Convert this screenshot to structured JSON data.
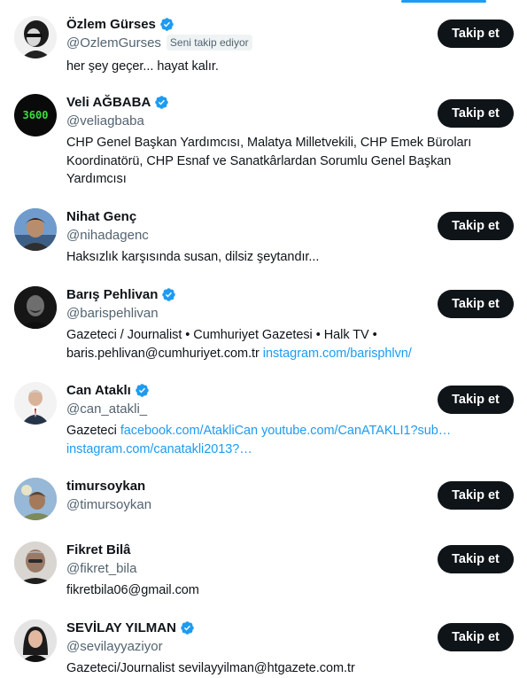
{
  "users": [
    {
      "name": "Özlem Gürses",
      "handle": "@OzlemGurses",
      "follows_you": "Seni takip ediyor",
      "bio": "her şey geçer... hayat kalır.",
      "bio_links": [],
      "verified": true,
      "follow_label": "Takip et"
    },
    {
      "name": "Veli AĞBABA",
      "handle": "@veliagbaba",
      "bio": "CHP Genel Başkan Yardımcısı, Malatya Milletvekili, CHP Emek Büroları Koordinatörü, CHP Esnaf ve Sanatkârlardan Sorumlu Genel Başkan Yardımcısı",
      "bio_links": [],
      "verified": true,
      "avatar_text": "3600",
      "follow_label": "Takip et"
    },
    {
      "name": "Nihat Genç",
      "handle": "@nihadagenc",
      "bio": "Haksızlık karşısında susan, dilsiz şeytandır...",
      "bio_links": [],
      "verified": false,
      "follow_label": "Takip et"
    },
    {
      "name": "Barış Pehlivan",
      "handle": "@barispehlivan",
      "bio": "Gazeteci / Journalist • Cumhuriyet Gazetesi • Halk TV • baris.pehlivan@cumhuriyet.com.tr",
      "bio_links": [
        "instagram.com/barisphlvn/"
      ],
      "verified": true,
      "follow_label": "Takip et"
    },
    {
      "name": "Can Ataklı",
      "handle": "@can_atakli_",
      "bio": "Gazeteci",
      "bio_links": [
        "facebook.com/AtakliCan",
        "youtube.com/CanATAKLI1?sub…",
        "instagram.com/canatakli2013?…"
      ],
      "verified": true,
      "follow_label": "Takip et"
    },
    {
      "name": "timursoykan",
      "handle": "@timursoykan",
      "bio": "",
      "bio_links": [],
      "verified": false,
      "follow_label": "Takip et"
    },
    {
      "name": "Fikret Bilâ",
      "handle": "@fikret_bila",
      "bio": "fikretbila06@gmail.com",
      "bio_links": [],
      "verified": false,
      "follow_label": "Takip et"
    },
    {
      "name": "SEVİLAY YILMAN",
      "handle": "@sevilayyaziyor",
      "bio": "Gazeteci/Journalist sevilayyilman@htgazete.com.tr",
      "bio_links": [],
      "verified": true,
      "follow_label": "Takip et"
    }
  ],
  "colors": {
    "link": "#1d9bf0",
    "verified": "#1d9bf0",
    "button_bg": "#0f1419",
    "secondary_text": "#536471"
  }
}
